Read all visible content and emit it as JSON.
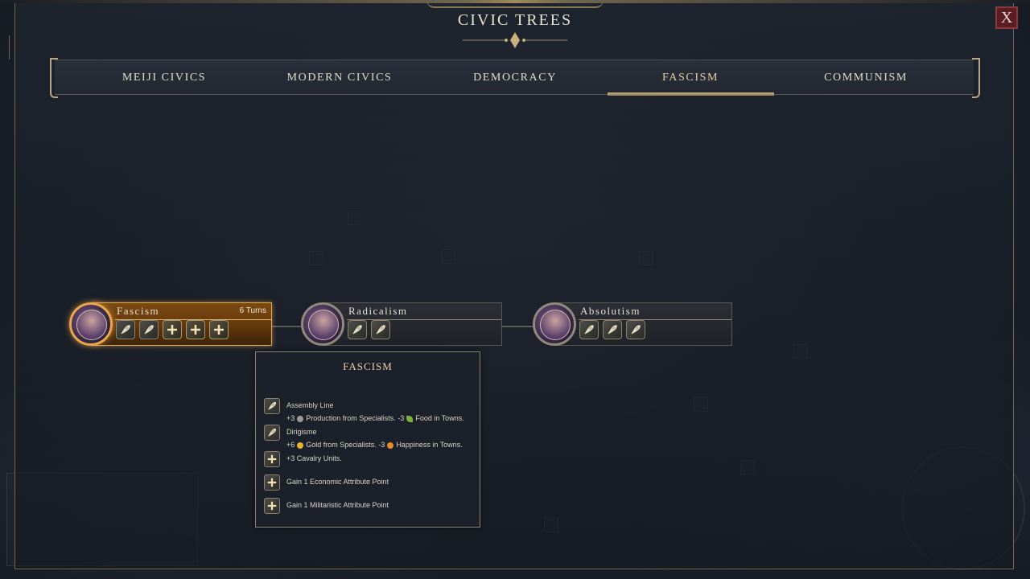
{
  "window": {
    "title": "CIVIC TREES",
    "close_label": "X"
  },
  "tabs": [
    {
      "label": "MEIJI CIVICS",
      "active": false
    },
    {
      "label": "MODERN CIVICS",
      "active": false
    },
    {
      "label": "DEMOCRACY",
      "active": false
    },
    {
      "label": "FASCISM",
      "active": true
    },
    {
      "label": "COMMUNISM",
      "active": false
    }
  ],
  "tree": {
    "nodes": [
      {
        "name": "Fascism",
        "turns": "6 Turns",
        "state": "researching",
        "portrait": "megaphone-portrait-icon",
        "slots": [
          "policy-leaf-icon",
          "policy-leaf-icon",
          "plus-icon",
          "plus-icon",
          "plus-icon"
        ]
      },
      {
        "name": "Radicalism",
        "turns": "",
        "state": "locked",
        "portrait": "fist-portrait-icon",
        "slots": [
          "policy-leaf-icon",
          "policy-leaf-icon"
        ]
      },
      {
        "name": "Absolutism",
        "turns": "",
        "state": "locked",
        "portrait": "crown-holder-portrait-icon",
        "slots": [
          "policy-leaf-icon",
          "policy-leaf-icon",
          "policy-leaf-icon"
        ]
      }
    ]
  },
  "tooltip": {
    "title": "FASCISM",
    "entries": [
      {
        "icon": "policy-leaf-icon",
        "text": "Assembly Line"
      },
      {
        "icon": "",
        "prefix": "+3",
        "icon1": "production-icon",
        "middle": "Production from Specialists. -3",
        "icon2": "food-icon",
        "suffix": "Food in Towns."
      },
      {
        "icon": "policy-leaf-icon",
        "text": "Dirigisme"
      },
      {
        "icon": "",
        "prefix": "+6",
        "icon1": "gold-icon",
        "middle": "Gold from Specialists. -3",
        "icon2": "happiness-icon",
        "suffix": "Happiness in Towns."
      },
      {
        "icon": "plus-icon",
        "text": "+3 Cavalry Units."
      },
      {
        "icon": "plus-icon",
        "text": "Gain 1 Economic Attribute Point"
      },
      {
        "icon": "plus-icon",
        "text": "Gain 1 Militaristic Attribute Point"
      }
    ]
  },
  "colors": {
    "accent_gold": "#cbb68a",
    "active_orange": "#e0a84a",
    "close_red": "#5a1e22"
  }
}
